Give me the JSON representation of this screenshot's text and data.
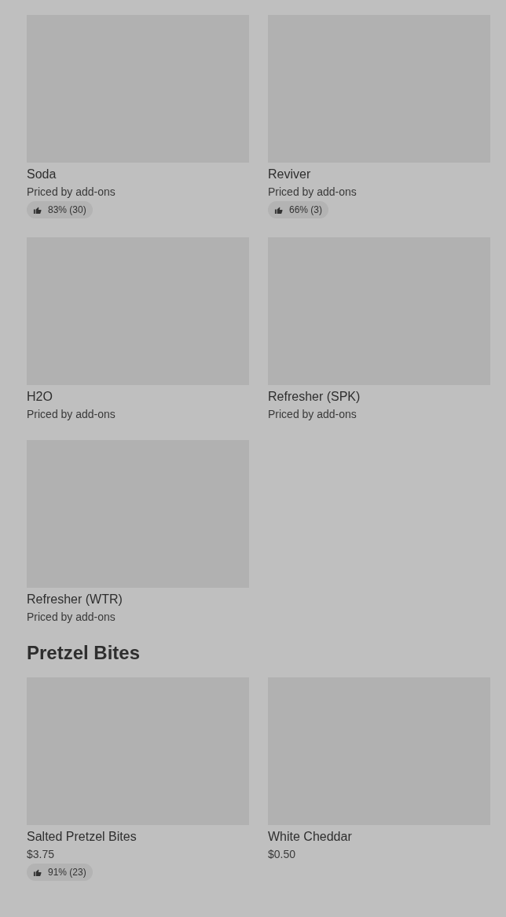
{
  "sections": [
    {
      "items": [
        {
          "name": "Soda",
          "price": "Priced by add-ons",
          "rating": "83% (30)"
        },
        {
          "name": "Reviver",
          "price": "Priced by add-ons",
          "rating": "66% (3)"
        },
        {
          "name": "H2O",
          "price": "Priced by add-ons"
        },
        {
          "name": "Refresher (SPK)",
          "price": "Priced by add-ons"
        },
        {
          "name": "Refresher (WTR)",
          "price": "Priced by add-ons"
        }
      ]
    },
    {
      "heading": "Pretzel Bites",
      "items": [
        {
          "name": "Salted Pretzel Bites",
          "price": "$3.75",
          "rating": "91% (23)"
        },
        {
          "name": "White Cheddar",
          "price": "$0.50"
        }
      ]
    }
  ]
}
